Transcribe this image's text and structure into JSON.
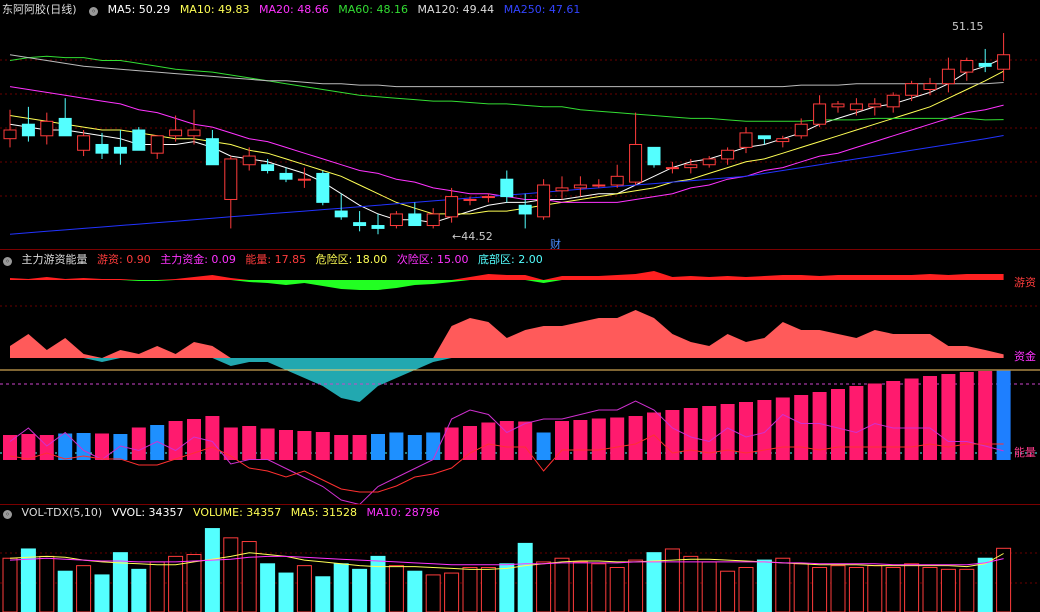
{
  "colors": {
    "up": "#ff3c3c",
    "down": "#54ffff",
    "ma5": "#ffffff",
    "ma10": "#ffff55",
    "ma20": "#ff33ff",
    "ma60": "#33dd33",
    "ma120": "#bbbbbb",
    "ma250": "#2233ff",
    "sep": "#7a0000",
    "grid": "#6a0000"
  },
  "main_header": {
    "title": "东阿阿胶(日线)",
    "ma5": "MA5: 50.29",
    "ma10": "MA10: 49.83",
    "ma20": "MA20: 48.66",
    "ma60": "MA60: 48.16",
    "ma120": "MA120: 49.44",
    "ma250": "MA250: 47.61"
  },
  "annotations": {
    "high_label": "51.15",
    "low_label": "44.52",
    "cai_marker": "财"
  },
  "energy_header": {
    "title": "主力游资能量",
    "youzi": "游资: 0.90",
    "zhuli": "主力资金: 0.09",
    "nengliang": "能量: 17.85",
    "weixian": "危险区: 18.00",
    "cixian": "次险区: 15.00",
    "dibu": "底部区: 2.00"
  },
  "energy_right_labels": {
    "youzi": "游资",
    "zijin": "资金",
    "nengliang": "能量"
  },
  "vol_header": {
    "title": "VOL-TDX(5,10)",
    "vvol": "VVOL: 34357",
    "volume": "VOLUME: 34357",
    "ma5": "MA5: 31528",
    "ma10": "MA10: 28796"
  },
  "chart_data": [
    {
      "type": "candlestick",
      "title": "东阿阿胶(日线)",
      "ylim": [
        44.0,
        51.6
      ],
      "candles": [
        {
          "o": 47.5,
          "h": 48.5,
          "l": 47.2,
          "c": 47.8
        },
        {
          "o": 48.0,
          "h": 48.6,
          "l": 47.4,
          "c": 47.6
        },
        {
          "o": 47.6,
          "h": 48.4,
          "l": 47.3,
          "c": 48.1
        },
        {
          "o": 48.2,
          "h": 48.9,
          "l": 47.6,
          "c": 47.6
        },
        {
          "o": 47.1,
          "h": 47.8,
          "l": 46.9,
          "c": 47.6
        },
        {
          "o": 47.3,
          "h": 47.7,
          "l": 46.8,
          "c": 47.0
        },
        {
          "o": 47.2,
          "h": 47.8,
          "l": 46.6,
          "c": 47.0
        },
        {
          "o": 47.8,
          "h": 47.9,
          "l": 47.1,
          "c": 47.1
        },
        {
          "o": 47.0,
          "h": 47.6,
          "l": 46.8,
          "c": 47.6
        },
        {
          "o": 47.6,
          "h": 48.3,
          "l": 47.4,
          "c": 47.8
        },
        {
          "o": 47.6,
          "h": 48.5,
          "l": 47.3,
          "c": 47.8
        },
        {
          "o": 47.5,
          "h": 47.8,
          "l": 46.6,
          "c": 46.6
        },
        {
          "o": 45.4,
          "h": 46.9,
          "l": 44.4,
          "c": 46.8
        },
        {
          "o": 46.6,
          "h": 47.2,
          "l": 46.4,
          "c": 46.9
        },
        {
          "o": 46.6,
          "h": 46.8,
          "l": 46.3,
          "c": 46.4
        },
        {
          "o": 46.3,
          "h": 46.5,
          "l": 46.0,
          "c": 46.1
        },
        {
          "o": 46.1,
          "h": 46.5,
          "l": 45.8,
          "c": 46.1
        },
        {
          "o": 46.3,
          "h": 46.4,
          "l": 45.2,
          "c": 45.3
        },
        {
          "o": 45.0,
          "h": 45.6,
          "l": 44.7,
          "c": 44.8
        },
        {
          "o": 44.6,
          "h": 45.0,
          "l": 44.3,
          "c": 44.5
        },
        {
          "o": 44.5,
          "h": 44.9,
          "l": 44.2,
          "c": 44.4
        },
        {
          "o": 44.5,
          "h": 45.0,
          "l": 44.4,
          "c": 44.9
        },
        {
          "o": 44.9,
          "h": 45.3,
          "l": 44.5,
          "c": 44.5
        },
        {
          "o": 44.5,
          "h": 45.1,
          "l": 44.4,
          "c": 44.9
        },
        {
          "o": 44.8,
          "h": 45.8,
          "l": 44.6,
          "c": 45.5
        },
        {
          "o": 45.4,
          "h": 45.5,
          "l": 45.2,
          "c": 45.4
        },
        {
          "o": 45.5,
          "h": 45.6,
          "l": 45.3,
          "c": 45.5
        },
        {
          "o": 46.1,
          "h": 46.4,
          "l": 45.3,
          "c": 45.5
        },
        {
          "o": 45.2,
          "h": 45.6,
          "l": 44.4,
          "c": 44.9
        },
        {
          "o": 44.8,
          "h": 46.1,
          "l": 44.7,
          "c": 45.9
        },
        {
          "o": 45.7,
          "h": 46.2,
          "l": 45.4,
          "c": 45.8
        },
        {
          "o": 45.8,
          "h": 46.2,
          "l": 45.5,
          "c": 45.9
        },
        {
          "o": 45.9,
          "h": 46.1,
          "l": 45.8,
          "c": 45.9
        },
        {
          "o": 45.9,
          "h": 46.6,
          "l": 45.8,
          "c": 46.2
        },
        {
          "o": 46.0,
          "h": 48.4,
          "l": 45.9,
          "c": 47.3
        },
        {
          "o": 47.2,
          "h": 47.2,
          "l": 46.5,
          "c": 46.6
        },
        {
          "o": 46.5,
          "h": 46.7,
          "l": 46.3,
          "c": 46.5
        },
        {
          "o": 46.5,
          "h": 46.8,
          "l": 46.3,
          "c": 46.6
        },
        {
          "o": 46.6,
          "h": 46.9,
          "l": 46.5,
          "c": 46.8
        },
        {
          "o": 46.8,
          "h": 47.2,
          "l": 46.6,
          "c": 47.1
        },
        {
          "o": 47.2,
          "h": 47.9,
          "l": 47.0,
          "c": 47.7
        },
        {
          "o": 47.6,
          "h": 47.6,
          "l": 47.3,
          "c": 47.5
        },
        {
          "o": 47.4,
          "h": 47.6,
          "l": 47.2,
          "c": 47.5
        },
        {
          "o": 47.6,
          "h": 48.2,
          "l": 47.5,
          "c": 48.0
        },
        {
          "o": 48.0,
          "h": 49.0,
          "l": 47.9,
          "c": 48.7
        },
        {
          "o": 48.6,
          "h": 48.8,
          "l": 48.4,
          "c": 48.7
        },
        {
          "o": 48.5,
          "h": 48.9,
          "l": 48.3,
          "c": 48.7
        },
        {
          "o": 48.6,
          "h": 48.9,
          "l": 48.3,
          "c": 48.7
        },
        {
          "o": 48.6,
          "h": 49.1,
          "l": 48.4,
          "c": 49.0
        },
        {
          "o": 49.0,
          "h": 49.5,
          "l": 48.8,
          "c": 49.4
        },
        {
          "o": 49.2,
          "h": 49.6,
          "l": 49.0,
          "c": 49.4
        },
        {
          "o": 49.4,
          "h": 50.3,
          "l": 49.1,
          "c": 49.9
        },
        {
          "o": 49.8,
          "h": 50.3,
          "l": 49.5,
          "c": 50.2
        },
        {
          "o": 50.1,
          "h": 50.6,
          "l": 49.8,
          "c": 50.0
        },
        {
          "o": 49.9,
          "h": 51.15,
          "l": 49.5,
          "c": 50.4
        }
      ],
      "ma": {
        "MA5": [
          48.0,
          47.9,
          47.8,
          47.8,
          47.7,
          47.6,
          47.5,
          47.3,
          47.3,
          47.3,
          47.4,
          47.2,
          46.9,
          46.8,
          46.7,
          46.5,
          46.3,
          46.0,
          45.6,
          45.2,
          44.9,
          44.7,
          44.7,
          44.6,
          44.8,
          45.0,
          45.2,
          45.3,
          45.3,
          45.4,
          45.4,
          45.5,
          45.6,
          45.6,
          45.9,
          46.2,
          46.5,
          46.7,
          46.8,
          47.0,
          47.2,
          47.3,
          47.5,
          47.7,
          48.0,
          48.2,
          48.4,
          48.6,
          48.7,
          48.9,
          49.1,
          49.4,
          49.8,
          50.0,
          50.29
        ],
        "MA10": [
          48.3,
          48.2,
          48.1,
          48.0,
          47.9,
          47.8,
          47.8,
          47.7,
          47.6,
          47.5,
          47.5,
          47.4,
          47.3,
          47.1,
          47.0,
          46.8,
          46.6,
          46.4,
          46.2,
          45.9,
          45.6,
          45.3,
          45.1,
          44.9,
          44.9,
          44.9,
          45.0,
          45.0,
          45.1,
          45.2,
          45.3,
          45.4,
          45.5,
          45.6,
          45.7,
          45.8,
          46.0,
          46.1,
          46.3,
          46.5,
          46.7,
          46.8,
          47.0,
          47.2,
          47.4,
          47.6,
          47.8,
          48.0,
          48.2,
          48.4,
          48.6,
          48.9,
          49.2,
          49.5,
          49.83
        ],
        "MA20": [
          49.3,
          49.2,
          49.1,
          49.0,
          48.9,
          48.8,
          48.7,
          48.5,
          48.4,
          48.2,
          48.0,
          47.9,
          47.7,
          47.5,
          47.4,
          47.2,
          47.0,
          46.8,
          46.6,
          46.4,
          46.3,
          46.1,
          46.0,
          45.8,
          45.7,
          45.6,
          45.6,
          45.5,
          45.4,
          45.4,
          45.3,
          45.3,
          45.3,
          45.3,
          45.4,
          45.5,
          45.6,
          45.8,
          45.9,
          46.1,
          46.2,
          46.4,
          46.5,
          46.7,
          46.9,
          47.0,
          47.2,
          47.4,
          47.6,
          47.8,
          48.0,
          48.2,
          48.4,
          48.5,
          48.66
        ],
        "MA60": [
          50.2,
          50.3,
          50.35,
          50.3,
          50.3,
          50.2,
          50.2,
          50.1,
          50.0,
          49.9,
          49.85,
          49.8,
          49.7,
          49.6,
          49.5,
          49.4,
          49.3,
          49.2,
          49.1,
          49.0,
          48.95,
          48.9,
          48.85,
          48.8,
          48.8,
          48.75,
          48.7,
          48.7,
          48.65,
          48.6,
          48.6,
          48.5,
          48.45,
          48.4,
          48.35,
          48.3,
          48.25,
          48.2,
          48.2,
          48.15,
          48.1,
          48.1,
          48.1,
          48.1,
          48.15,
          48.15,
          48.15,
          48.2,
          48.2,
          48.2,
          48.2,
          48.2,
          48.2,
          48.15,
          48.16
        ],
        "MA120": [
          50.4,
          50.3,
          50.2,
          50.1,
          50.0,
          49.95,
          49.9,
          49.85,
          49.8,
          49.75,
          49.7,
          49.65,
          49.6,
          49.55,
          49.5,
          49.5,
          49.45,
          49.4,
          49.4,
          49.35,
          49.35,
          49.3,
          49.3,
          49.3,
          49.3,
          49.3,
          49.3,
          49.3,
          49.3,
          49.3,
          49.3,
          49.3,
          49.3,
          49.3,
          49.3,
          49.3,
          49.3,
          49.3,
          49.3,
          49.3,
          49.3,
          49.3,
          49.3,
          49.35,
          49.35,
          49.35,
          49.4,
          49.4,
          49.4,
          49.4,
          49.4,
          49.4,
          49.4,
          49.4,
          49.44
        ],
        "MA250": [
          44.2,
          44.25,
          44.3,
          44.35,
          44.4,
          44.45,
          44.5,
          44.55,
          44.6,
          44.65,
          44.7,
          44.75,
          44.8,
          44.85,
          44.9,
          44.95,
          45.0,
          45.05,
          45.1,
          45.15,
          45.2,
          45.25,
          45.3,
          45.35,
          45.4,
          45.45,
          45.5,
          45.55,
          45.6,
          45.65,
          45.7,
          45.75,
          45.8,
          45.85,
          45.9,
          45.95,
          46.0,
          46.05,
          46.1,
          46.15,
          46.2,
          46.3,
          46.4,
          46.5,
          46.6,
          46.7,
          46.8,
          46.9,
          47.0,
          47.1,
          47.2,
          47.3,
          47.4,
          47.5,
          47.61
        ]
      }
    },
    {
      "type": "area",
      "title": "主力游资能量",
      "series": [
        {
          "name": "游资",
          "values": [
            0.2,
            0.1,
            0.3,
            0.1,
            0.2,
            0.1,
            0.1,
            -0.1,
            -0.1,
            0.1,
            0.3,
            0.5,
            0.2,
            -0.2,
            -0.3,
            -0.5,
            -0.3,
            -0.6,
            -0.9,
            -1.0,
            -1.0,
            -0.8,
            -0.5,
            -0.4,
            -0.2,
            0.3,
            0.6,
            0.5,
            0.5,
            -0.3,
            0.4,
            0.4,
            0.4,
            0.5,
            0.6,
            0.9,
            0.3,
            0.4,
            0.3,
            0.4,
            0.3,
            0.4,
            0.5,
            0.5,
            0.4,
            0.5,
            0.5,
            0.5,
            0.5,
            0.5,
            0.6,
            0.5,
            0.6,
            0.6,
            0.6
          ]
        },
        {
          "name": "主力资金",
          "values": [
            0.3,
            0.6,
            0.2,
            0.5,
            0.1,
            -0.1,
            0.2,
            0.1,
            0.3,
            0.1,
            0.4,
            0.3,
            -0.2,
            -0.1,
            -0.1,
            -0.3,
            -0.5,
            -0.7,
            -1.0,
            -1.1,
            -0.7,
            -0.5,
            -0.3,
            -0.1,
            0.8,
            1.0,
            0.9,
            0.5,
            0.7,
            0.8,
            0.8,
            0.9,
            1.0,
            1.0,
            1.2,
            1.0,
            0.6,
            0.4,
            0.3,
            0.6,
            0.4,
            0.5,
            0.9,
            0.7,
            0.7,
            0.6,
            0.5,
            0.7,
            0.6,
            0.6,
            0.6,
            0.3,
            0.3,
            0.2,
            0.09
          ]
        },
        {
          "name": "能量",
          "values": [
            5.0,
            5.2,
            5.0,
            5.3,
            5.4,
            5.3,
            5.2,
            6.5,
            7.0,
            7.8,
            8.2,
            8.8,
            6.5,
            6.8,
            6.3,
            6.0,
            5.8,
            5.6,
            5.0,
            5.0,
            5.2,
            5.5,
            5.0,
            5.5,
            6.5,
            6.8,
            7.5,
            7.8,
            7.7,
            5.5,
            7.8,
            8.0,
            8.3,
            8.5,
            8.8,
            9.5,
            10.0,
            10.4,
            10.8,
            11.2,
            11.6,
            12.0,
            12.5,
            13.0,
            13.6,
            14.2,
            14.8,
            15.3,
            15.8,
            16.3,
            16.8,
            17.2,
            17.6,
            17.8,
            17.85
          ]
        }
      ],
      "levels": {
        "危险区": 18.0,
        "次险区": 15.0,
        "底部区": 2.0
      }
    },
    {
      "type": "bar",
      "title": "VOL-TDX(5,10)",
      "values": [
        29000,
        34000,
        30000,
        22000,
        25000,
        20000,
        32000,
        23000,
        27000,
        30000,
        31000,
        45000,
        40000,
        38000,
        26000,
        21000,
        25000,
        19000,
        26000,
        23000,
        30000,
        25000,
        22000,
        20000,
        21000,
        24000,
        24000,
        26000,
        37000,
        27000,
        29000,
        27000,
        26000,
        24000,
        28000,
        32000,
        34000,
        30000,
        27000,
        22000,
        24000,
        28000,
        29000,
        26000,
        24000,
        25000,
        24000,
        25000,
        24000,
        26000,
        24000,
        23000,
        23000,
        29000,
        34357
      ],
      "ma5": [
        29000,
        29500,
        30000,
        29500,
        28000,
        27000,
        26500,
        26000,
        25500,
        25500,
        27000,
        28500,
        30000,
        32000,
        31000,
        30000,
        28000,
        27000,
        26000,
        25000,
        24500,
        24500,
        24500,
        24000,
        23500,
        23000,
        23000,
        23500,
        25000,
        26000,
        27000,
        27500,
        27500,
        27000,
        27000,
        27500,
        28000,
        28500,
        28500,
        28000,
        27500,
        27000,
        26500,
        26000,
        25500,
        25500,
        25500,
        25000,
        25000,
        25000,
        25000,
        25000,
        24500,
        26000,
        31528
      ],
      "ma10": [
        28000,
        28500,
        29000,
        28500,
        28000,
        27500,
        27500,
        27000,
        27000,
        27000,
        27500,
        28000,
        28500,
        29500,
        30000,
        30000,
        29500,
        29000,
        28500,
        28000,
        27500,
        27000,
        26500,
        26000,
        25500,
        25500,
        25500,
        25500,
        26000,
        26000,
        26500,
        26500,
        26500,
        26500,
        27000,
        27000,
        27000,
        27000,
        27000,
        27000,
        27000,
        27000,
        26500,
        26500,
        26000,
        26000,
        26000,
        26000,
        25500,
        25500,
        25500,
        25500,
        25500,
        26500,
        28796
      ],
      "ylim": [
        0,
        48000
      ]
    }
  ]
}
